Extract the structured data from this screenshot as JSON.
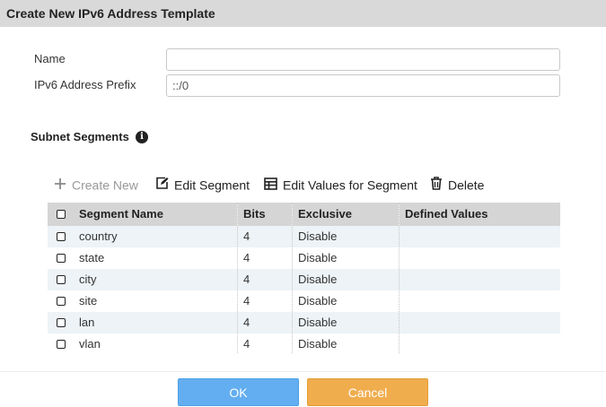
{
  "dialog": {
    "title": "Create New IPv6 Address Template"
  },
  "form": {
    "name_label": "Name",
    "name_value": "",
    "prefix_label": "IPv6 Address Prefix",
    "prefix_value": "::/0"
  },
  "section": {
    "title": "Subnet Segments"
  },
  "toolbar": {
    "create_new": "Create New",
    "edit_segment": "Edit Segment",
    "edit_values": "Edit Values for Segment",
    "delete": "Delete"
  },
  "table": {
    "columns": [
      "Segment Name",
      "Bits",
      "Exclusive",
      "Defined Values"
    ],
    "rows": [
      {
        "name": "country",
        "bits": "4",
        "exclusive": "Disable",
        "defined": ""
      },
      {
        "name": "state",
        "bits": "4",
        "exclusive": "Disable",
        "defined": ""
      },
      {
        "name": "city",
        "bits": "4",
        "exclusive": "Disable",
        "defined": ""
      },
      {
        "name": "site",
        "bits": "4",
        "exclusive": "Disable",
        "defined": ""
      },
      {
        "name": "lan",
        "bits": "4",
        "exclusive": "Disable",
        "defined": ""
      },
      {
        "name": "vlan",
        "bits": "4",
        "exclusive": "Disable",
        "defined": ""
      }
    ]
  },
  "buttons": {
    "ok": "OK",
    "cancel": "Cancel"
  },
  "colors": {
    "ok": "#63aef0",
    "cancel": "#f0ad4e",
    "row_alt": "#edf3f7",
    "header": "#d5d5d5"
  },
  "icons": {
    "create": "plus-icon",
    "edit": "edit-icon",
    "table": "table-icon",
    "delete": "trash-icon",
    "info": "info-icon"
  }
}
